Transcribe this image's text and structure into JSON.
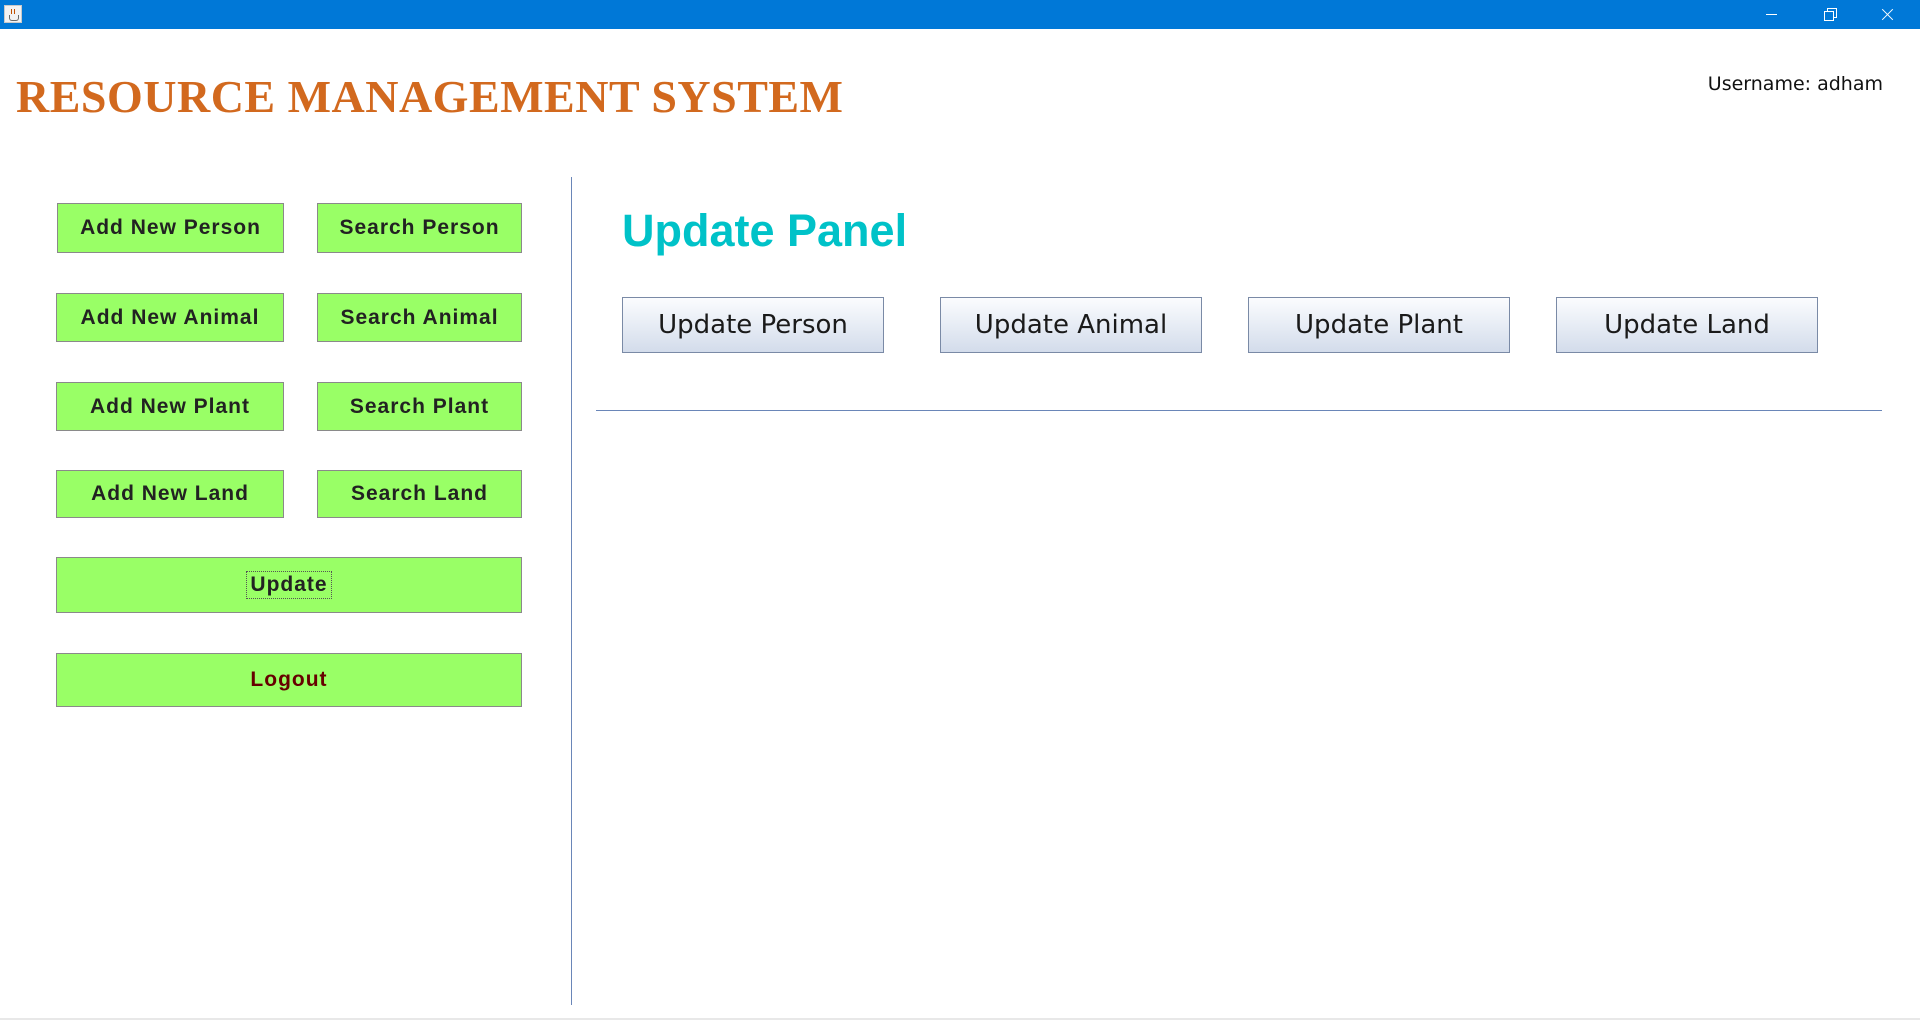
{
  "window": {
    "icon": "java-cup-icon",
    "controls": {
      "minimize": "minimize-icon",
      "maximize": "restore-icon",
      "close": "close-icon"
    }
  },
  "header": {
    "title": "RESOURCE MANAGEMENT SYSTEM",
    "username": "Username: adham"
  },
  "sidebar": {
    "add_person": "Add New Person",
    "search_person": "Search Person",
    "add_animal": "Add New Animal",
    "search_animal": "Search Animal",
    "add_plant": "Add New Plant",
    "search_plant": "Search Plant",
    "add_land": "Add New Land",
    "search_land": "Search Land",
    "update": "Update",
    "logout": "Logout"
  },
  "panel": {
    "title": "Update Panel",
    "buttons": [
      "Update Person",
      "Update Animal",
      "Update Plant",
      "Update Land"
    ]
  },
  "colors": {
    "titlebar": "#0078d7",
    "app_title": "#d2691e",
    "panel_title": "#00c2c8",
    "green_button": "#99ff66",
    "logout_text": "#660000"
  }
}
